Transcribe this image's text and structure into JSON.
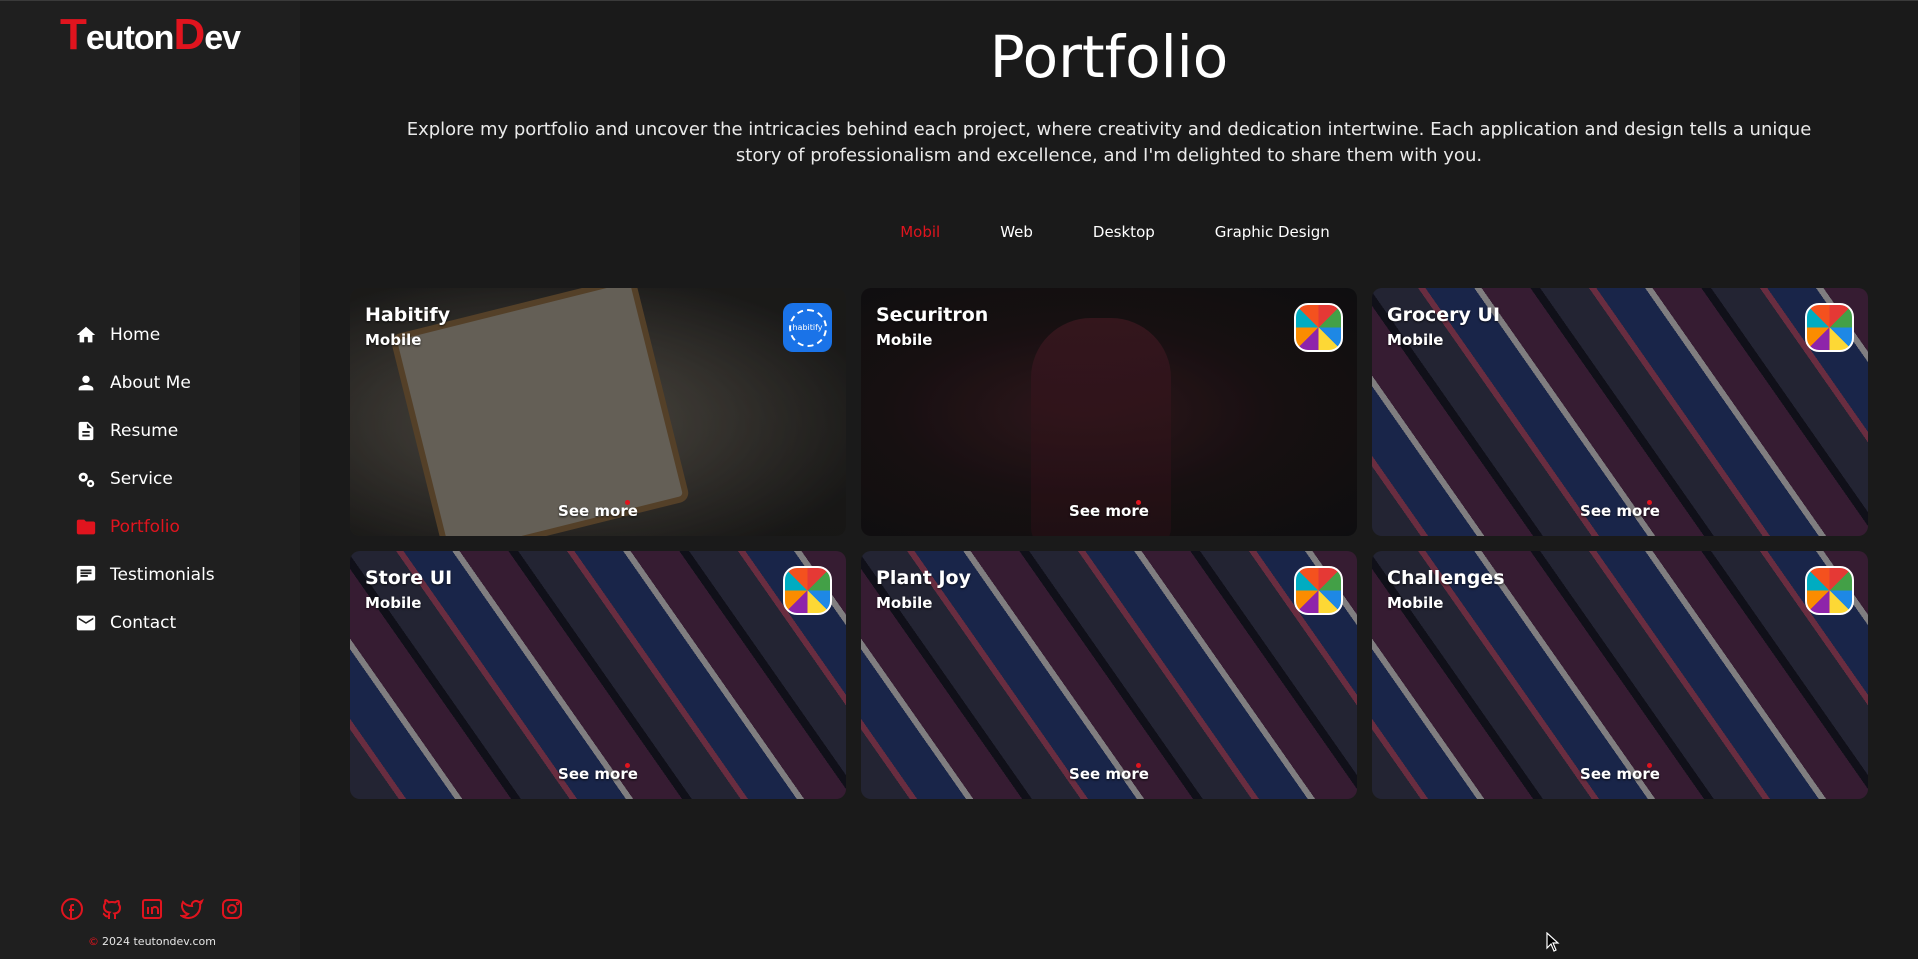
{
  "brand": {
    "logo_t": "T",
    "logo_part1": "euton",
    "logo_d": "D",
    "logo_part2": "ev",
    "accent_color": "#e0141e"
  },
  "sidebar": {
    "items": [
      {
        "label": "Home",
        "icon": "home-icon",
        "active": false
      },
      {
        "label": "About Me",
        "icon": "person-icon",
        "active": false
      },
      {
        "label": "Resume",
        "icon": "document-icon",
        "active": false
      },
      {
        "label": "Service",
        "icon": "gears-icon",
        "active": false
      },
      {
        "label": "Portfolio",
        "icon": "folder-icon",
        "active": true
      },
      {
        "label": "Testimonials",
        "icon": "comment-icon",
        "active": false
      },
      {
        "label": "Contact",
        "icon": "mail-icon",
        "active": false
      }
    ],
    "socials": [
      "facebook-icon",
      "github-icon",
      "linkedin-icon",
      "twitter-icon",
      "instagram-icon"
    ],
    "copyright": "2024 teutondev.com",
    "copyright_symbol": "©"
  },
  "main": {
    "title": "Portfolio",
    "intro": "Explore my portfolio and uncover the intricacies behind each project, where creativity and dedication intertwine. Each application and design tells a unique story of professionalism and excellence, and I'm delighted to share them with you.",
    "tabs": [
      {
        "label": "Mobil",
        "active": true
      },
      {
        "label": "Web",
        "active": false
      },
      {
        "label": "Desktop",
        "active": false
      },
      {
        "label": "Graphic Design",
        "active": false
      }
    ],
    "cards": [
      {
        "title": "Habitify",
        "category": "Mobile",
        "cta": "See more",
        "logo_text": "habitify"
      },
      {
        "title": "Securitron",
        "category": "Mobile",
        "cta": "See more"
      },
      {
        "title": "Grocery UI",
        "category": "Mobile",
        "cta": "See more"
      },
      {
        "title": "Store UI",
        "category": "Mobile",
        "cta": "See more"
      },
      {
        "title": "Plant Joy",
        "category": "Mobile",
        "cta": "See more"
      },
      {
        "title": "Challenges",
        "category": "Mobile",
        "cta": "See more"
      }
    ]
  }
}
